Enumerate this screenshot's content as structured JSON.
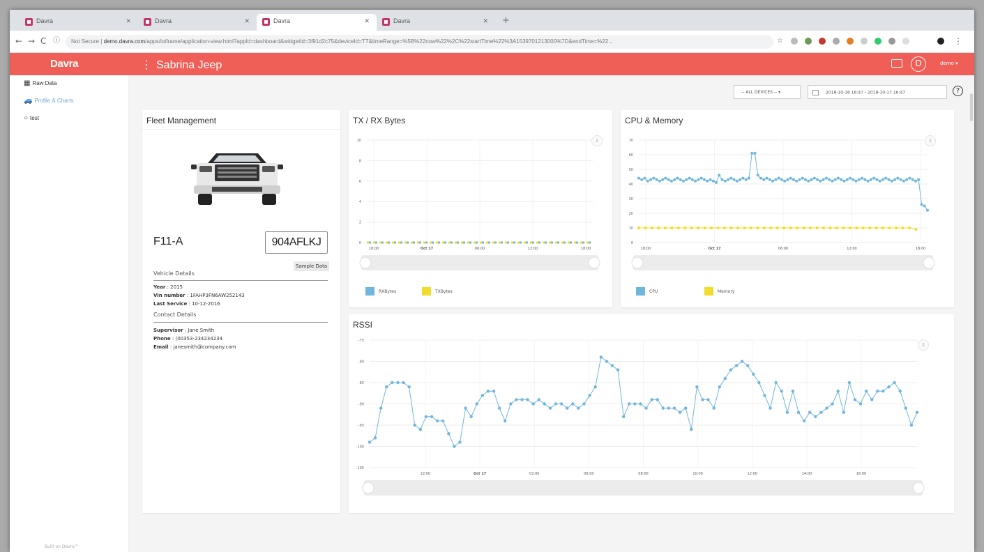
{
  "browser": {
    "tabs": [
      {
        "label": "Davra",
        "active": false
      },
      {
        "label": "Davra",
        "active": false
      },
      {
        "label": "Davra",
        "active": true
      },
      {
        "label": "Davra",
        "active": false
      }
    ],
    "security_label": "Not Secure",
    "url_host": "demo.davra.com",
    "url_rest": "/apps/iotframe/application-view.html?appId=dashboard&widgetId=3f91d2c75&deviceId=TT&timeRange=%5B%22now%22%2C%22startTime%22%3A1539701213000%7D&endTime=%22..."
  },
  "app": {
    "logo": "Davra",
    "title": "Sabrina Jeep",
    "avatar_initial": "D",
    "user": "demo ▾"
  },
  "sidebar": {
    "items": [
      {
        "label": "Raw Data"
      },
      {
        "label": "Profile & Charts"
      },
      {
        "label": "test"
      }
    ],
    "footer": "Built on Davra™"
  },
  "toolbar": {
    "devices": "-- ALL DEVICES --  ▾",
    "range": "2018-10-16 16:47 - 2018-10-17 16:47",
    "help": "?"
  },
  "fleet": {
    "title": "Fleet Management",
    "model": "F11-A",
    "plate": "904AFLKJ",
    "sample_button": "Sample Data",
    "vehicle_header": "Vehicle Details",
    "vehicle": [
      {
        "key": "Year",
        "value": "2015"
      },
      {
        "key": "Vin number",
        "value": "1FAHP3FN6AW252143"
      },
      {
        "key": "Last Service",
        "value": "10-12-2016"
      }
    ],
    "contact_header": "Contact Details",
    "contact": [
      {
        "key": "Supervisor",
        "value": "Jane Smith"
      },
      {
        "key": "Phone",
        "value": "(00353-234234234"
      },
      {
        "key": "Email",
        "value": "janesmith@company.com"
      }
    ]
  },
  "colors": {
    "accent": "#ef5f58",
    "rx": "#6fb6dc",
    "tx": "#f0dc2a",
    "cpu": "#6fb6dc",
    "memory": "#f0dc2a"
  },
  "chart_data": [
    {
      "id": "txrx",
      "type": "line",
      "title": "TX / RX Bytes",
      "ylim": [
        0,
        10
      ],
      "yticks": [
        0,
        2,
        4,
        6,
        8,
        10
      ],
      "xticks": [
        "18:00",
        "Oct 17",
        "06:00",
        "12:00",
        "18:00"
      ],
      "series": [
        {
          "name": "RXBytes",
          "values": [
            0,
            0,
            0,
            0,
            0,
            0,
            0,
            0,
            0,
            0,
            0,
            0,
            0,
            0,
            0,
            0,
            0,
            0,
            0,
            0,
            0,
            0,
            0,
            0,
            0,
            0,
            0,
            0,
            0,
            0,
            0,
            0,
            0,
            0,
            0,
            0,
            0,
            0,
            0,
            0
          ]
        },
        {
          "name": "TXBytes",
          "values": [
            0,
            0,
            0,
            0,
            0,
            0,
            0,
            0,
            0,
            0,
            0,
            0,
            0,
            0,
            0,
            0,
            0,
            0,
            0,
            0,
            0,
            0,
            0,
            0,
            0,
            0,
            0,
            0,
            0,
            0,
            0,
            0,
            0,
            0,
            0,
            0,
            0,
            0,
            0,
            0
          ]
        }
      ]
    },
    {
      "id": "cpu",
      "type": "line",
      "title": "CPU & Memory",
      "ylim": [
        0,
        70
      ],
      "yticks": [
        0,
        10,
        20,
        30,
        40,
        50,
        60,
        70
      ],
      "xticks": [
        "18:00",
        "Oct 17",
        "06:00",
        "12:00",
        "18:00"
      ],
      "series": [
        {
          "name": "CPU",
          "values": [
            44,
            43,
            44,
            42,
            43,
            44,
            43,
            42,
            43,
            44,
            43,
            42,
            43,
            44,
            43,
            42,
            43,
            44,
            43,
            42,
            43,
            44,
            43,
            42,
            43,
            42,
            41,
            46,
            43,
            42,
            43,
            44,
            43,
            42,
            43,
            44,
            43,
            44,
            61,
            61,
            46,
            44,
            43,
            44,
            43,
            42,
            43,
            44,
            43,
            42,
            43,
            44,
            43,
            42,
            43,
            44,
            43,
            42,
            43,
            44,
            43,
            42,
            43,
            44,
            43,
            42,
            43,
            44,
            43,
            42,
            43,
            44,
            43,
            42,
            43,
            44,
            43,
            42,
            43,
            44,
            43,
            42,
            43,
            44,
            43,
            42,
            43,
            44,
            43,
            42,
            43,
            44,
            43,
            42,
            43,
            26,
            25,
            22
          ]
        },
        {
          "name": "Memory",
          "values": [
            10,
            10,
            10,
            10,
            10,
            10,
            10,
            10,
            10,
            10,
            10,
            10,
            10,
            10,
            10,
            10,
            10,
            10,
            10,
            10,
            10,
            10,
            10,
            10,
            10,
            10,
            10,
            10,
            10,
            10,
            10,
            10,
            10,
            10,
            10,
            10,
            10,
            10,
            10,
            10,
            10,
            10,
            9
          ]
        }
      ]
    },
    {
      "id": "rssi",
      "type": "line",
      "title": "RSSI",
      "ylim": [
        -105,
        -75
      ],
      "yticks": [
        -75,
        -80,
        -85,
        -90,
        -95,
        -100,
        -105
      ],
      "xticks": [
        "22:00",
        "Oct 17",
        "02:00",
        "06:00",
        "08:00",
        "10:00",
        "12:00",
        "14:00",
        "16:00"
      ],
      "series": [
        {
          "name": "RSSI",
          "values": [
            -99,
            -98,
            -91,
            -86,
            -85,
            -85,
            -85,
            -86,
            -95,
            -96,
            -93,
            -93,
            -94,
            -94,
            -97,
            -100,
            -99,
            -91,
            -93,
            -90,
            -88,
            -87,
            -87,
            -91,
            -94,
            -90,
            -89,
            -89,
            -89,
            -90,
            -89,
            -90,
            -91,
            -90,
            -90,
            -91,
            -90,
            -91,
            -90,
            -88,
            -86,
            -79,
            -80,
            -81,
            -82,
            -93,
            -90,
            -90,
            -90,
            -91,
            -89,
            -89,
            -91,
            -91,
            -91,
            -92,
            -91,
            -96,
            -86,
            -89,
            -89,
            -91,
            -86,
            -84,
            -82,
            -81,
            -80,
            -81,
            -83,
            -85,
            -88,
            -91,
            -85,
            -87,
            -92,
            -87,
            -92,
            -94,
            -92,
            -93,
            -92,
            -91,
            -90,
            -87,
            -92,
            -85,
            -89,
            -90,
            -87,
            -89,
            -87,
            -87,
            -86,
            -85,
            -87,
            -91,
            -95,
            -92
          ]
        }
      ]
    }
  ]
}
